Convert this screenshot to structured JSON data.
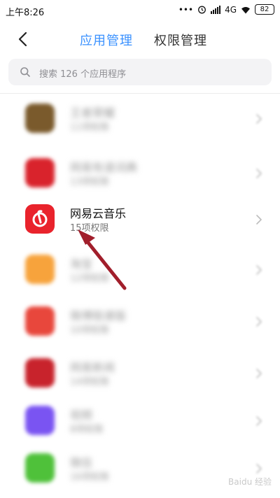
{
  "status_bar": {
    "time": "上午8:26",
    "network": "4G",
    "battery": "82"
  },
  "header": {
    "tabs": [
      {
        "label": "应用管理"
      },
      {
        "label": "权限管理"
      }
    ]
  },
  "search": {
    "placeholder": "搜索 126 个应用程序"
  },
  "app_list": [
    {
      "name": "王者荣耀",
      "permissions": "11项权限",
      "icon_color": "#7a5a2c",
      "blurred": true
    },
    {
      "name": "网易有道词典",
      "permissions": "13项权限",
      "icon_color": "#d9232c",
      "blurred": true
    },
    {
      "name": "网易云音乐",
      "permissions": "15项权限",
      "icon_color": "#e9232c",
      "blurred": false
    },
    {
      "name": "淘宝",
      "permissions": "12项权限",
      "icon_color": "#f7a33c",
      "blurred": true
    },
    {
      "name": "微博极速版",
      "permissions": "10项权限",
      "icon_color": "#e8473c",
      "blurred": true
    },
    {
      "name": "网易新闻",
      "permissions": "14项权限",
      "icon_color": "#c8232c",
      "blurred": true
    },
    {
      "name": "视频",
      "permissions": "8项权限",
      "icon_color": "#7a54f2",
      "blurred": true
    },
    {
      "name": "微信",
      "permissions": "16项权限",
      "icon_color": "#4fc13a",
      "blurred": true
    }
  ],
  "watermark": "Baidu 经验"
}
